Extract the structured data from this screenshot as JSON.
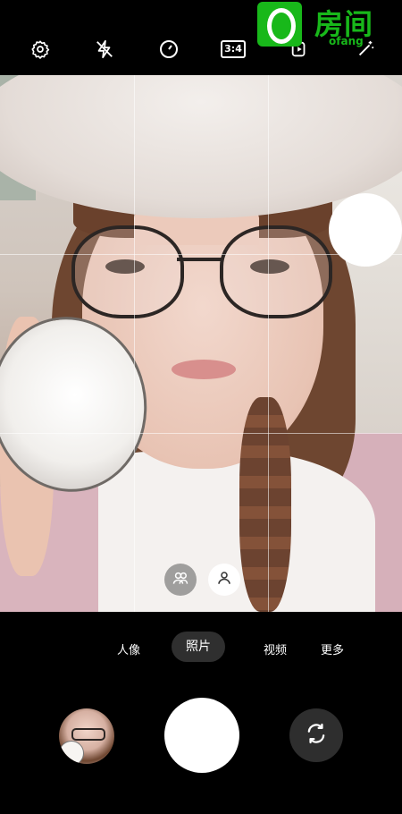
{
  "top_bar": {
    "icons": [
      "gear-icon",
      "flash-off-icon",
      "timer-icon",
      "aspect-ratio-icon",
      "motion-photo-icon",
      "magic-wand-icon"
    ],
    "aspect_ratio_label": "3:4"
  },
  "watermark": {
    "logo_letter": "O",
    "brand_cn": "房间",
    "brand_en": "ofang",
    "color": "#18b81a"
  },
  "viewfinder": {
    "grid": "3x3",
    "overlay_buttons": [
      "multi-face-icon",
      "single-face-icon"
    ]
  },
  "modes": {
    "items": [
      "人像",
      "照片",
      "视频",
      "更多"
    ],
    "active": "照片"
  },
  "bottom_controls": {
    "gallery": "gallery-thumbnail",
    "shutter": "shutter-button",
    "switch_camera": "switch-camera-icon"
  }
}
